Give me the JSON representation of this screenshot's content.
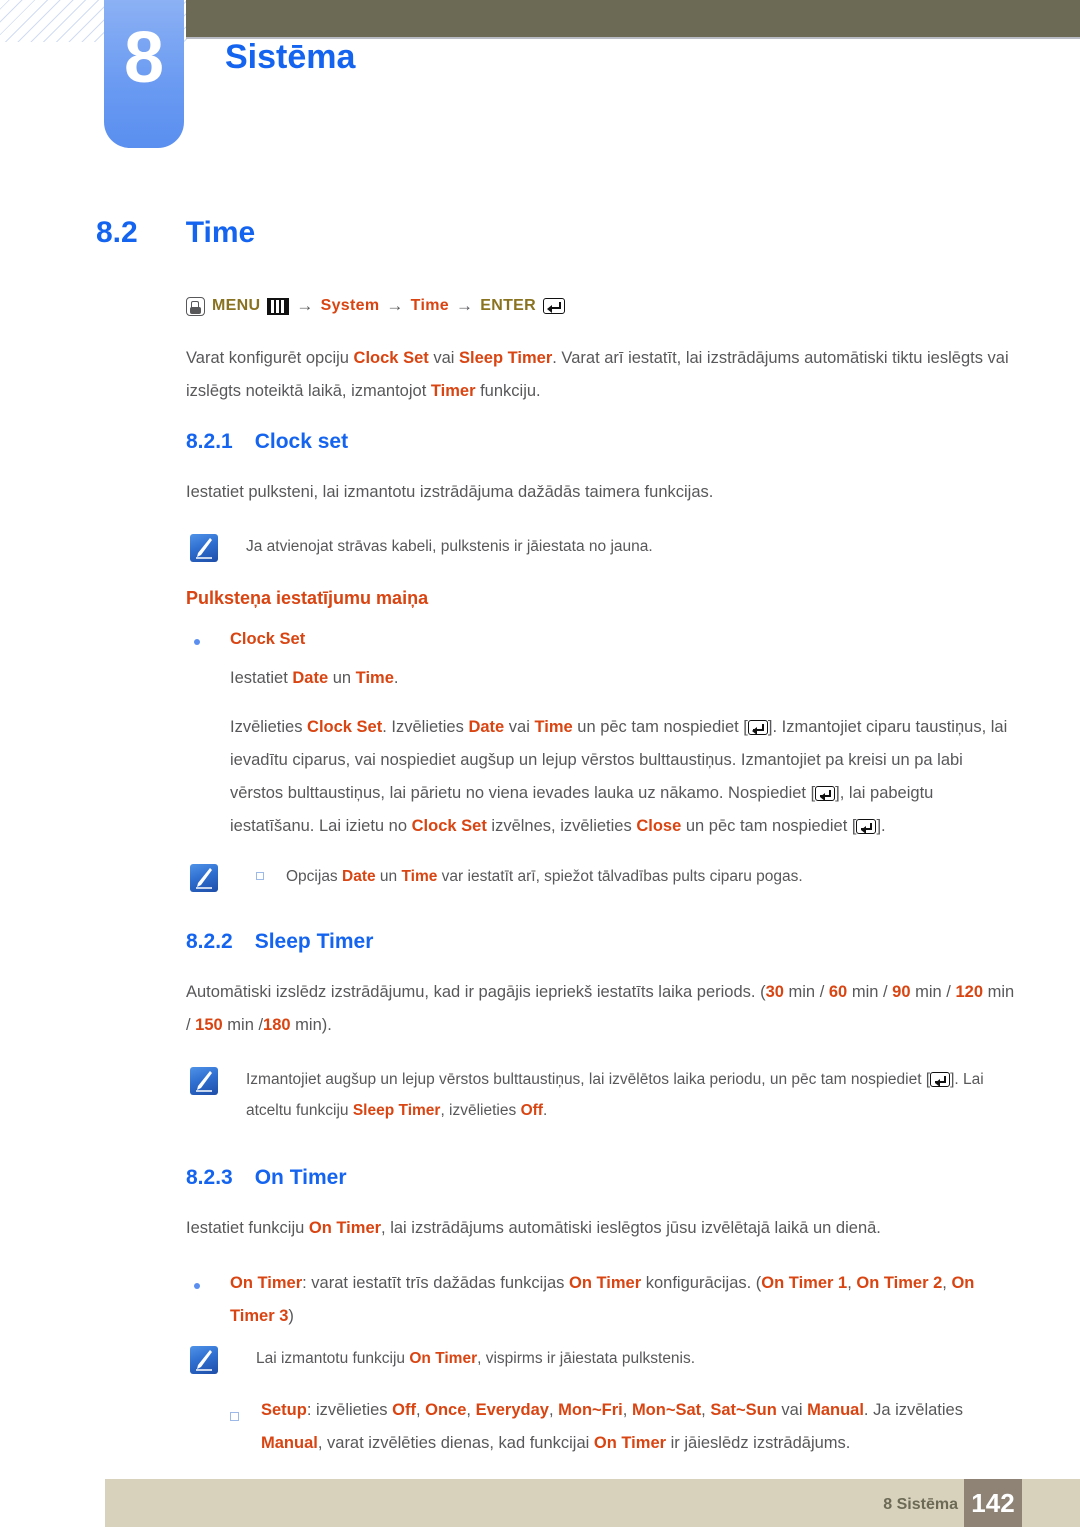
{
  "header": {
    "chapter_number": "8",
    "chapter_title": "Sistēma"
  },
  "section": {
    "number": "8.2",
    "title": "Time"
  },
  "menu_path": {
    "hand_icon": "hand-press-icon",
    "menu_label": "MENU",
    "menu_icon": "menu-bars-icon",
    "arrow1": "→",
    "item1": "System",
    "arrow2": "→",
    "item2": "Time",
    "arrow3": "→",
    "enter_label": "ENTER",
    "enter_icon": "enter-key-icon"
  },
  "intro": {
    "p1_a": "Varat konfigurēt opciju ",
    "p1_hl1": "Clock Set",
    "p1_b": " vai ",
    "p1_hl2": "Sleep Timer",
    "p1_c": ". Varat arī iestatīt, lai izstrādājums automātiski tiktu ieslēgts vai izslēgts noteiktā laikā, izmantojot ",
    "p1_hl3": "Timer",
    "p1_d": " funkciju."
  },
  "clock_set": {
    "number": "8.2.1",
    "title": "Clock set",
    "intro": "Iestatiet pulksteni, lai izmantotu izstrādājuma dažādās taimera funkcijas.",
    "note1": "Ja atvienojat strāvas kabeli, pulkstenis ir jāiestata no jauna.",
    "orange_title": "Pulksteņa iestatījumu maiņa",
    "bullet_label": "Clock Set",
    "sub1_a": "Iestatiet ",
    "sub1_hl1": "Date",
    "sub1_b": " un ",
    "sub1_hl2": "Time",
    "sub1_c": ".",
    "sub2_a": "Izvēlieties ",
    "sub2_hl1": "Clock Set",
    "sub2_b": ". Izvēlieties ",
    "sub2_hl2": "Date",
    "sub2_c": " vai ",
    "sub2_hl3": "Time",
    "sub2_d": " un pēc tam nospiediet [",
    "sub2_e": "]. Izmantojiet ciparu taustiņus, lai ievadītu ciparus, vai nospiediet augšup un lejup vērstos bulttaustiņus. Izmantojiet pa kreisi un pa labi vērstos bulttaustiņus, lai pārietu no viena ievades lauka uz nākamo. Nospiediet [",
    "sub2_f": "], lai pabeigtu iestatīšanu. Lai izietu no ",
    "sub2_hl4": "Clock Set",
    "sub2_g": " izvēlnes, izvēlieties ",
    "sub2_hl5": "Close",
    "sub2_h": " un pēc tam nospiediet [",
    "sub2_i": "].",
    "note2_a": "Opcijas ",
    "note2_hl1": "Date",
    "note2_b": " un ",
    "note2_hl2": "Time",
    "note2_c": " var iestatīt arī, spiežot tālvadības pults ciparu pogas."
  },
  "sleep_timer": {
    "number": "8.2.2",
    "title": "Sleep Timer",
    "p_a": "Automātiski izslēdz izstrādājumu, kad ir pagājis iepriekš iestatīts laika periods. (",
    "opt1": "30",
    "opt1_u": " min / ",
    "opt2": "60",
    "opt2_u": " min / ",
    "opt3": "90",
    "opt3_u": " min / ",
    "opt4": "120",
    "opt4_u": " min / ",
    "opt5": "150",
    "opt5_u": " min /",
    "opt6": "180",
    "opt6_u": " min).",
    "note_a": "Izmantojiet augšup un lejup vērstos bulttaustiņus, lai izvēlētos laika periodu, un pēc tam nospiediet [",
    "note_b": "]. Lai atceltu funkciju ",
    "note_hl1": "Sleep Timer",
    "note_c": ", izvēlieties ",
    "note_hl2": "Off",
    "note_d": "."
  },
  "on_timer": {
    "number": "8.2.3",
    "title": "On Timer",
    "p_a": "Iestatiet funkciju ",
    "p_hl1": "On Timer",
    "p_b": ", lai izstrādājums automātiski ieslēgtos jūsu izvēlētajā laikā un dienā.",
    "b1_hl1": "On Timer",
    "b1_a": ": varat iestatīt trīs dažādas funkcijas ",
    "b1_hl2": "On Timer",
    "b1_b": " konfigurācijas. (",
    "b1_hl3": "On Timer 1",
    "b1_c": ", ",
    "b1_hl4": "On Timer 2",
    "b1_d": ", ",
    "b1_hl5": "On Timer 3",
    "b1_e": ")",
    "note_a": "Lai izmantotu funkciju ",
    "note_hl1": "On Timer",
    "note_b": ", vispirms ir jāiestata pulkstenis.",
    "setup_hl0": "Setup",
    "setup_a": ": izvēlieties ",
    "setup_hl1": "Off",
    "setup_s1": ", ",
    "setup_hl2": "Once",
    "setup_s2": ", ",
    "setup_hl3": "Everyday",
    "setup_s3": ", ",
    "setup_hl4": "Mon~Fri",
    "setup_s4": ", ",
    "setup_hl5": "Mon~Sat",
    "setup_s5": ", ",
    "setup_hl6": "Sat~Sun",
    "setup_s6": " vai ",
    "setup_hl7": "Manual",
    "setup_b": ". Ja izvēlaties ",
    "setup_hl8": "Manual",
    "setup_c": ", varat izvēlēties dienas, kad funkcijai ",
    "setup_hl9": "On Timer",
    "setup_d": " ir jāieslēdz izstrādājums."
  },
  "footer": {
    "label": "8 Sistēma",
    "page": "142"
  },
  "colors": {
    "accent_blue": "#1464f0",
    "highlight_orange": "#d94512",
    "header_olive": "#6c6a55",
    "footer_beige": "#d8d2bd",
    "page_box": "#8f8376",
    "badge_blue": "#6b9bf2"
  }
}
